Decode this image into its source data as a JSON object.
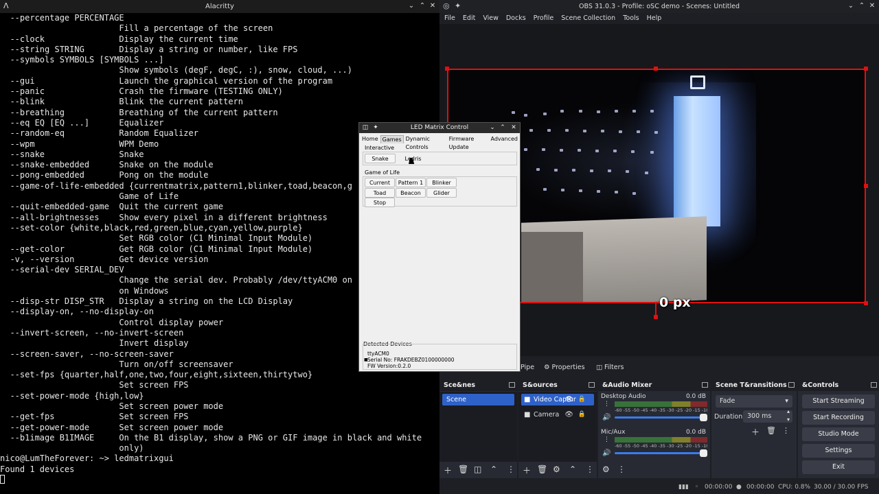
{
  "terminal": {
    "title": "Alacritty",
    "lines": [
      "  --percentage PERCENTAGE",
      "                        Fill a percentage of the screen",
      "  --clock               Display the current time",
      "  --string STRING       Display a string or number, like FPS",
      "  --symbols SYMBOLS [SYMBOLS ...]",
      "                        Show symbols (degF, degC, :), snow, cloud, ...)",
      "  --gui                 Launch the graphical version of the program",
      "  --panic               Crash the firmware (TESTING ONLY)",
      "  --blink               Blink the current pattern",
      "  --breathing           Breathing of the current pattern",
      "  --eq EQ [EQ ...]      Equalizer",
      "  --random-eq           Random Equalizer",
      "  --wpm                 WPM Demo",
      "  --snake               Snake",
      "  --snake-embedded      Snake on the module",
      "  --pong-embedded       Pong on the module",
      "  --game-of-life-embedded {currentmatrix,pattern1,blinker,toad,beacon,g",
      "                        Game of Life",
      "  --quit-embedded-game  Quit the current game",
      "  --all-brightnesses    Show every pixel in a different brightness",
      "  --set-color {white,black,red,green,blue,cyan,yellow,purple}",
      "                        Set RGB color (C1 Minimal Input Module)",
      "  --get-color           Get RGB color (C1 Minimal Input Module)",
      "  -v, --version         Get device version",
      "  --serial-dev SERIAL_DEV",
      "                        Change the serial dev. Probably /dev/ttyACM0 on",
      "                        on Windows",
      "  --disp-str DISP_STR   Display a string on the LCD Display",
      "  --display-on, --no-display-on",
      "                        Control display power",
      "  --invert-screen, --no-invert-screen",
      "                        Invert display",
      "  --screen-saver, --no-screen-saver",
      "                        Turn on/off screensaver",
      "  --set-fps {quarter,half,one,two,four,eight,sixteen,thirtytwo}",
      "                        Set screen FPS",
      "  --set-power-mode {high,low}",
      "                        Set screen power mode",
      "  --get-fps             Set screen FPS",
      "  --get-power-mode      Set screen power mode",
      "  --b1image B1IMAGE     On the B1 display, show a PNG or GIF image in black and white",
      "                        only)",
      "nico@LumTheForever: ~> ledmatrixgui",
      "Found 1 devices"
    ]
  },
  "obs": {
    "title": "OBS 31.0.3 - Profile: oSC demo - Scenes: Untitled",
    "menu": [
      "File",
      "Edit",
      "View",
      "Docks",
      "Profile",
      "Scene Collection",
      "Tools",
      "Help"
    ],
    "px_label": "0 px",
    "toolbar": {
      "pipe_label": "Pipe",
      "properties_label": "Properties",
      "filters_label": "Filters"
    },
    "scenes": {
      "title": "Sce&nes",
      "items": [
        "Scene"
      ]
    },
    "sources": {
      "title": "S&ources",
      "items": [
        {
          "label": "Video Captur",
          "icon": "video-capture-icon"
        },
        {
          "label": "Camera",
          "icon": "camera-icon"
        }
      ]
    },
    "mixer": {
      "title": "&Audio Mixer",
      "channels": [
        {
          "name": "Desktop Audio",
          "db": "0.0 dB"
        },
        {
          "name": "Mic/Aux",
          "db": "0.0 dB"
        }
      ],
      "scale": "-60 -55 -50 -45 -40 -35 -30 -25 -20 -15 -10 -5 0"
    },
    "transitions": {
      "title": "Scene T&ransitions",
      "selected": "Fade",
      "duration_label": "Duration",
      "duration_value": "300 ms"
    },
    "controls": {
      "title": "&Controls",
      "buttons": [
        "Start Streaming",
        "Start Recording",
        "Studio Mode",
        "Settings",
        "Exit"
      ]
    },
    "status": {
      "stream_time": "00:00:00",
      "rec_time": "00:00:00",
      "cpu": "CPU: 0.8%",
      "fps": "30.00 / 30.00 FPS"
    },
    "colors": {
      "accent": "#2f62c8",
      "selection": "#e01010"
    }
  },
  "led": {
    "title": "LED Matrix Control",
    "tabs": [
      "Home",
      "Games",
      "Dynamic Controls",
      "Firmware Update",
      "Advanced"
    ],
    "active_tab": "Games",
    "interactive_label": "Interactive",
    "interactive_buttons": [
      "Snake",
      "Ledris"
    ],
    "gol_label": "Game of Life",
    "gol_buttons": [
      "Current",
      "Pattern 1",
      "Blinker",
      "Toad",
      "Beacon",
      "Glider",
      "Stop"
    ],
    "detected_label": "Detected Devices",
    "device_name": "ttyACM0",
    "serial": "Serial No: FRAKDEBZ0100000000",
    "fw": "FW Version:0.2.0"
  }
}
